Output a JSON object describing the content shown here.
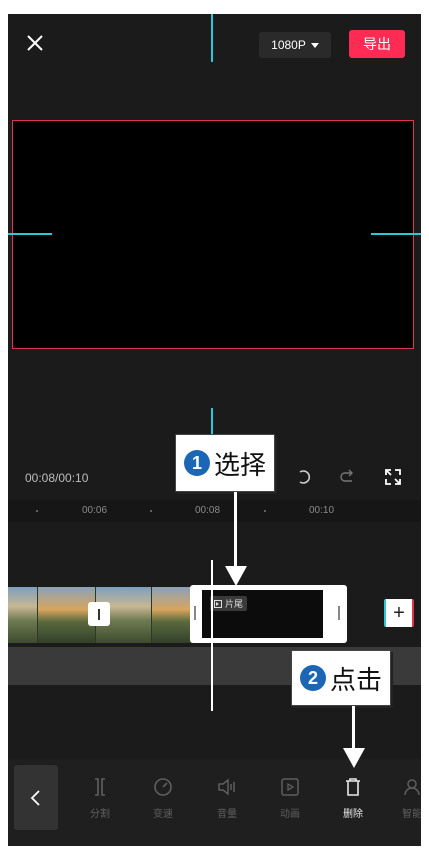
{
  "topbar": {
    "resolution": "1080P",
    "export_label": "导出"
  },
  "controls": {
    "timecode": "00:08/00:10"
  },
  "ruler": {
    "labels": [
      "00:06",
      "00:08",
      "00:10"
    ]
  },
  "timeline": {
    "end_clip_label": "片尾",
    "add_label": "+"
  },
  "toolbar": {
    "tools": [
      {
        "label": "分割",
        "icon": "split-icon"
      },
      {
        "label": "变速",
        "icon": "speed-icon"
      },
      {
        "label": "音量",
        "icon": "volume-icon"
      },
      {
        "label": "动画",
        "icon": "animation-icon"
      },
      {
        "label": "删除",
        "icon": "delete-icon"
      },
      {
        "label": "智能",
        "icon": "smart-icon"
      }
    ]
  },
  "annotations": {
    "step1_num": "1",
    "step1_text": "选择",
    "step2_num": "2",
    "step2_text": "点击"
  },
  "colors": {
    "export": "#fe2c55",
    "guide": "#2ec6d9",
    "preview_border": "#e0344e",
    "step_badge": "#1b66b5"
  }
}
